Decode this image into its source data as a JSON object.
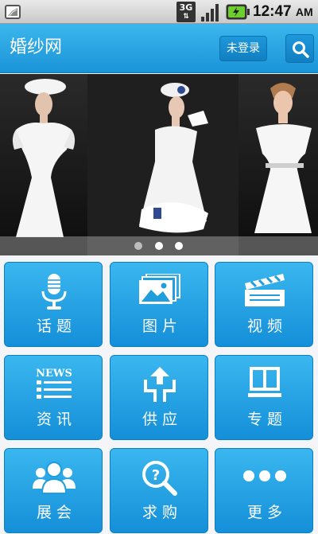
{
  "status_bar": {
    "network": "3G",
    "time": "12:47",
    "ampm": "AM",
    "icons": [
      "notification-icon",
      "signal-icon",
      "battery-charging-icon"
    ]
  },
  "header": {
    "title": "婚纱网",
    "login_label": "未登录",
    "search_icon": "search-icon",
    "color": "#1f9ddd"
  },
  "banner": {
    "slide_count": 3,
    "active_slide": 2
  },
  "menu": {
    "items": [
      {
        "label": "话题",
        "icon": "microphone-icon"
      },
      {
        "label": "图片",
        "icon": "pictures-icon"
      },
      {
        "label": "视频",
        "icon": "clapperboard-icon"
      },
      {
        "label": "资讯",
        "icon": "news-icon"
      },
      {
        "label": "供应",
        "icon": "supply-icon"
      },
      {
        "label": "专题",
        "icon": "topic-icon"
      },
      {
        "label": "展会",
        "icon": "people-icon"
      },
      {
        "label": "求购",
        "icon": "question-search-icon"
      },
      {
        "label": "更多",
        "icon": "more-icon"
      }
    ],
    "news_icon_text": "NEWS",
    "tile_color": "#1f9ddd"
  }
}
